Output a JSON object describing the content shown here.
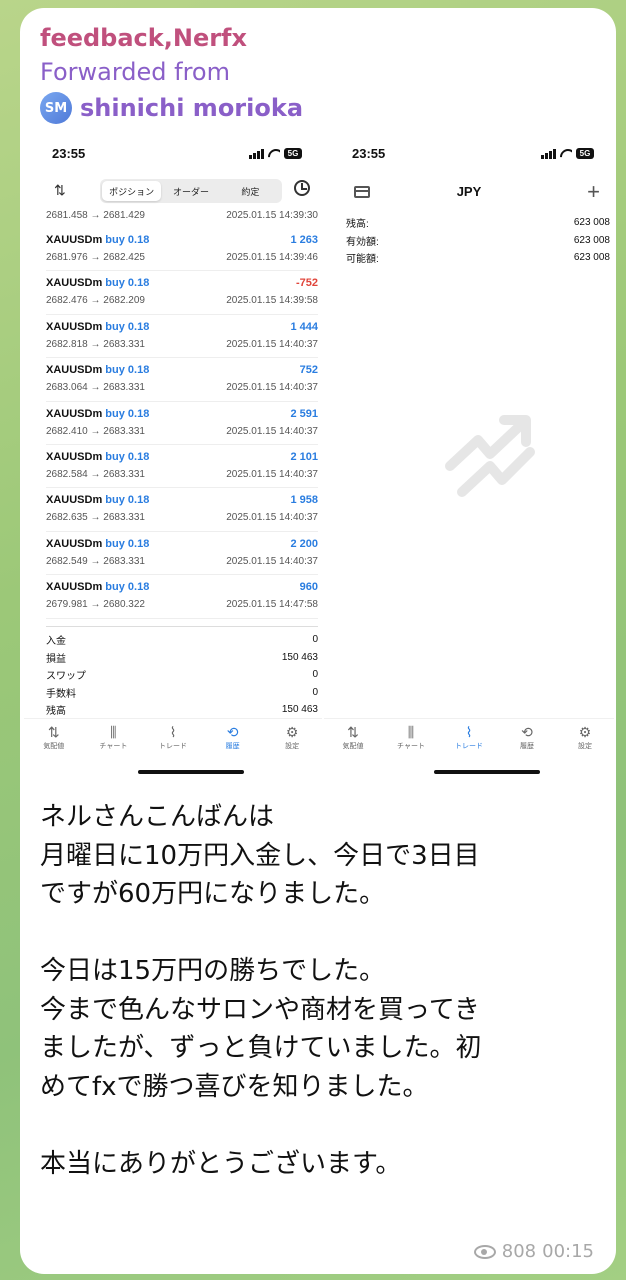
{
  "message": {
    "sender": "feedback,Nerfx",
    "forwarded_label": "Forwarded from",
    "original_author": {
      "initials": "SM",
      "name": "shinichi morioka"
    },
    "text_lines": [
      "ネルさんこんばんは",
      "月曜日に10万円入金し、今日で3日目",
      "ですが60万円になりました。",
      "",
      "今日は15万円の勝ちでした。",
      "今まで色んなサロンや商材を買ってき",
      "ましたが、ずっと負けていました。初",
      "めてfxで勝つ喜びを知りました。",
      "",
      "本当にありがとうございます。"
    ],
    "views": "808",
    "time": "00:15"
  },
  "left_screen": {
    "status_time": "23:55",
    "battery": "5G",
    "segments": [
      "ポジション",
      "オーダー",
      "約定"
    ],
    "active_segment": 0,
    "first_row": {
      "prices": "2681.458 → 2681.429",
      "time": "2025.01.15 14:39:30"
    },
    "deals": [
      {
        "symbol": "XAUUSDm",
        "side": "buy 0.18",
        "profit": "1 263",
        "negative": false,
        "prices": "2681.976 → 2682.425",
        "time": "2025.01.15 14:39:46"
      },
      {
        "symbol": "XAUUSDm",
        "side": "buy 0.18",
        "profit": "-752",
        "negative": true,
        "prices": "2682.476 → 2682.209",
        "time": "2025.01.15 14:39:58"
      },
      {
        "symbol": "XAUUSDm",
        "side": "buy 0.18",
        "profit": "1 444",
        "negative": false,
        "prices": "2682.818 → 2683.331",
        "time": "2025.01.15 14:40:37"
      },
      {
        "symbol": "XAUUSDm",
        "side": "buy 0.18",
        "profit": "752",
        "negative": false,
        "prices": "2683.064 → 2683.331",
        "time": "2025.01.15 14:40:37"
      },
      {
        "symbol": "XAUUSDm",
        "side": "buy 0.18",
        "profit": "2 591",
        "negative": false,
        "prices": "2682.410 → 2683.331",
        "time": "2025.01.15 14:40:37"
      },
      {
        "symbol": "XAUUSDm",
        "side": "buy 0.18",
        "profit": "2 101",
        "negative": false,
        "prices": "2682.584 → 2683.331",
        "time": "2025.01.15 14:40:37"
      },
      {
        "symbol": "XAUUSDm",
        "side": "buy 0.18",
        "profit": "1 958",
        "negative": false,
        "prices": "2682.635 → 2683.331",
        "time": "2025.01.15 14:40:37"
      },
      {
        "symbol": "XAUUSDm",
        "side": "buy 0.18",
        "profit": "2 200",
        "negative": false,
        "prices": "2682.549 → 2683.331",
        "time": "2025.01.15 14:40:37"
      },
      {
        "symbol": "XAUUSDm",
        "side": "buy 0.18",
        "profit": "960",
        "negative": false,
        "prices": "2679.981 → 2680.322",
        "time": "2025.01.15 14:47:58"
      }
    ],
    "summary": [
      {
        "label": "入金",
        "value": "0"
      },
      {
        "label": "損益",
        "value": "150 463"
      },
      {
        "label": "スワップ",
        "value": "0"
      },
      {
        "label": "手数料",
        "value": "0"
      },
      {
        "label": "残高",
        "value": "150 463"
      }
    ],
    "active_tab": 3
  },
  "right_screen": {
    "status_time": "23:55",
    "battery": "5G",
    "currency": "JPY",
    "balances": [
      {
        "label": "残高:",
        "value": "623 008"
      },
      {
        "label": "有効額:",
        "value": "623 008"
      },
      {
        "label": "可能額:",
        "value": "623 008"
      }
    ],
    "active_tab": 2
  },
  "tabs": [
    {
      "label": "気配値",
      "icon": "arrows-updown-icon",
      "glyph": "⇅"
    },
    {
      "label": "チャート",
      "icon": "candlestick-icon",
      "glyph": "⫼"
    },
    {
      "label": "トレード",
      "icon": "chart-line-icon",
      "glyph": "⌇"
    },
    {
      "label": "履歴",
      "icon": "history-icon",
      "glyph": "⟲"
    },
    {
      "label": "設定",
      "icon": "gear-icon",
      "glyph": "⚙"
    }
  ],
  "colors": {
    "profit": "#2a7de0",
    "loss": "#e0443a",
    "sender": "#c0507d",
    "forward": "#8a5fc8"
  }
}
